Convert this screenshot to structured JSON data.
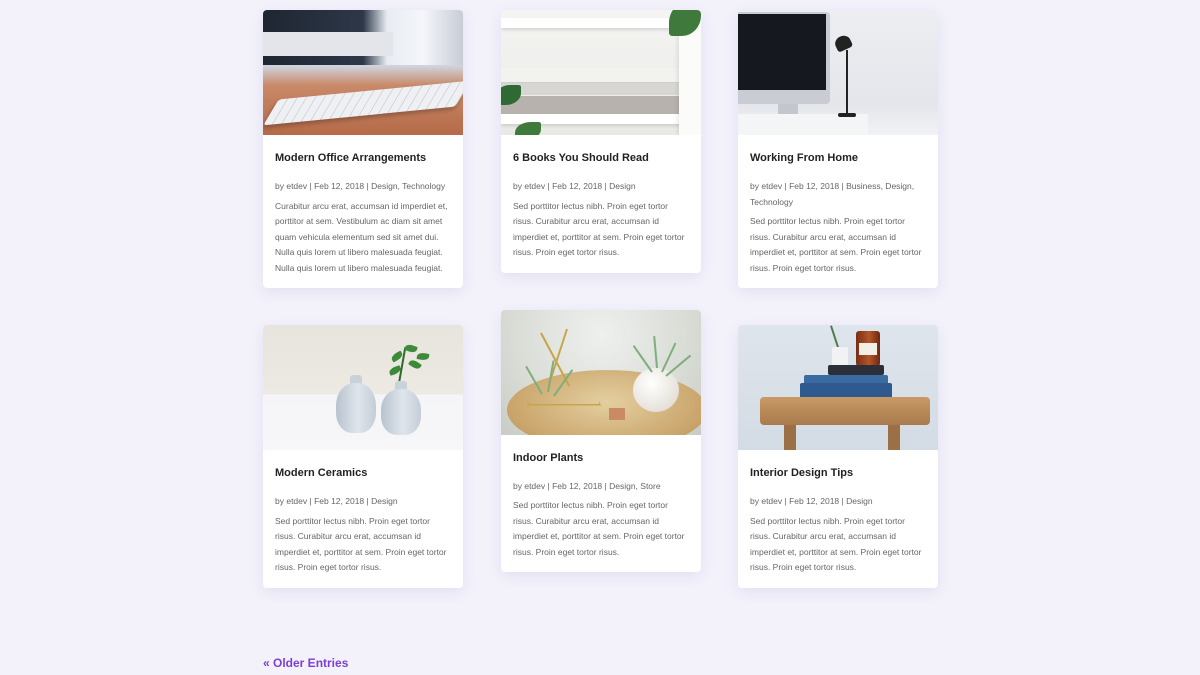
{
  "posts": [
    {
      "title": "Modern Office Arrangements",
      "meta": "by etdev | Feb 12, 2018 | Design, Technology",
      "excerpt": "Curabitur arcu erat, accumsan id imperdiet et, porttitor at sem. Vestibulum ac diam sit amet quam vehicula elementum sed sit amet dui. Nulla quis lorem ut libero malesuada feugiat. Nulla quis lorem ut libero malesuada feugiat."
    },
    {
      "title": "6 Books You Should Read",
      "meta": "by etdev | Feb 12, 2018 | Design",
      "excerpt": "Sed porttitor lectus nibh. Proin eget tortor risus. Curabitur arcu erat, accumsan id imperdiet et, porttitor at sem. Proin eget tortor risus. Proin eget tortor risus."
    },
    {
      "title": "Working From Home",
      "meta": "by etdev | Feb 12, 2018 | Business, Design, Technology",
      "excerpt": "Sed porttitor lectus nibh. Proin eget tortor risus. Curabitur arcu erat, accumsan id imperdiet et, porttitor at sem. Proin eget tortor risus. Proin eget tortor risus."
    },
    {
      "title": "Modern Ceramics",
      "meta": "by etdev | Feb 12, 2018 | Design",
      "excerpt": "Sed porttitor lectus nibh. Proin eget tortor risus. Curabitur arcu erat, accumsan id imperdiet et, porttitor at sem. Proin eget tortor risus. Proin eget tortor risus."
    },
    {
      "title": "Indoor Plants",
      "meta": "by etdev | Feb 12, 2018 | Design, Store",
      "excerpt": "Sed porttitor lectus nibh. Proin eget tortor risus. Curabitur arcu erat, accumsan id imperdiet et, porttitor at sem. Proin eget tortor risus. Proin eget tortor risus."
    },
    {
      "title": "Interior Design Tips",
      "meta": "by etdev | Feb 12, 2018 | Design",
      "excerpt": "Sed porttitor lectus nibh. Proin eget tortor risus. Curabitur arcu erat, accumsan id imperdiet et, porttitor at sem. Proin eget tortor risus. Proin eget tortor risus."
    }
  ],
  "pagination": {
    "older_label": "« Older Entries"
  },
  "colors": {
    "page_bg": "#f3f2fb",
    "accent": "#7b3fd6",
    "card_bg": "#ffffff"
  }
}
